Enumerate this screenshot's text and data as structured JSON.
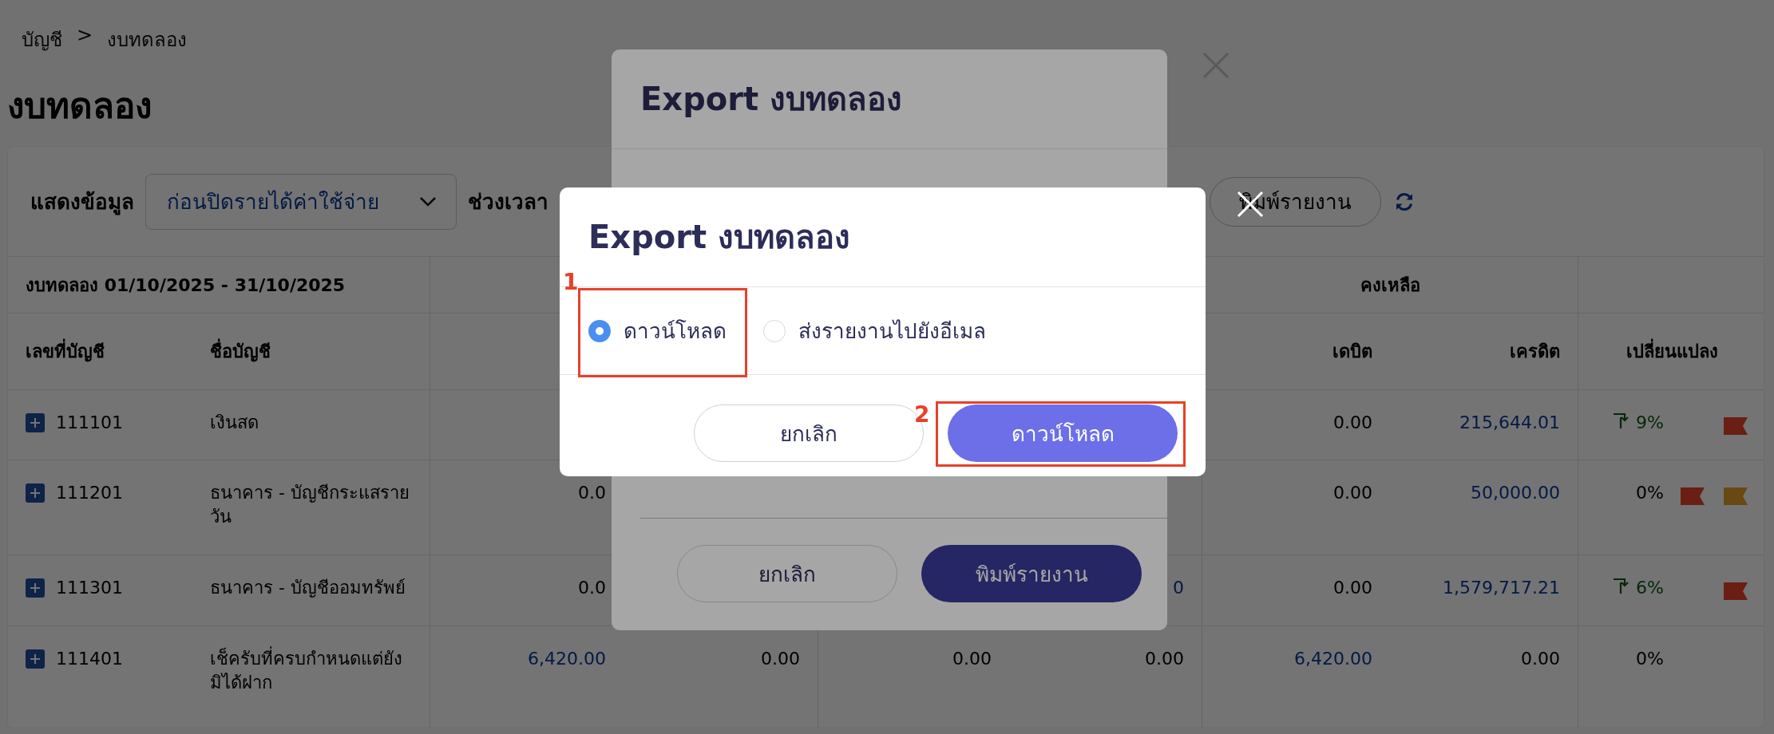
{
  "breadcrumb": [
    "บัญชี",
    ">",
    "งบทดลอง"
  ],
  "page_title": "งบทดลอง",
  "filters": {
    "show_label": "แสดงข้อมูล",
    "show_value": "ก่อนปิดรายได้ค่าใช้จ่าย",
    "period_label": "ช่วงเวลา",
    "print_button": "พิมพ์รายงาน"
  },
  "table": {
    "caption": "งบทดลอง 01/10/2025 - 31/10/2025",
    "group": "คงเหลือ",
    "columns": [
      "เลขที่บัญชี",
      "ชื่อบัญชี",
      "เดบิต",
      "เครดิต",
      "เปลี่ยนแปลง"
    ],
    "rows": [
      {
        "code": "111101",
        "name": "เงินสด",
        "cells": [
          null,
          null,
          null,
          null
        ],
        "debit": {
          "text": "0.00",
          "link": false
        },
        "credit": {
          "text": "215,644.01",
          "link": true
        },
        "change": "9%",
        "trend_up": true,
        "flags": [
          {
            "color": "#6a2014"
          }
        ]
      },
      {
        "code": "111201",
        "name": "ธนาคาร - บัญชีกระแสรายวัน",
        "cells": [
          {
            "text": "0.0",
            "link": false
          },
          null,
          null,
          null
        ],
        "debit": {
          "text": "0.00",
          "link": false
        },
        "credit": {
          "text": "50,000.00",
          "link": true
        },
        "change": "0%",
        "trend_up": false,
        "flags": [
          {
            "color": "#6a2014"
          },
          {
            "color": "#6a4a14"
          }
        ]
      },
      {
        "code": "111301",
        "name": "ธนาคาร - บัญชีออมทรัพย์",
        "cells": [
          {
            "text": "0.0",
            "link": false
          },
          null,
          null,
          {
            "text": "0",
            "link": true
          }
        ],
        "debit": {
          "text": "0.00",
          "link": false
        },
        "credit": {
          "text": "1,579,717.21",
          "link": true
        },
        "change": "6%",
        "trend_up": true,
        "flags": [
          {
            "color": "#6a2014"
          }
        ]
      },
      {
        "code": "111401",
        "name": "เช็ครับที่ครบกำหนดแต่ยังมิได้ฝาก",
        "cells": [
          {
            "text": "6,420.00",
            "link": true
          },
          {
            "text": "0.00",
            "link": false
          },
          {
            "text": "0.00",
            "link": false
          },
          {
            "text": "0.00",
            "link": false
          }
        ],
        "debit": {
          "text": "6,420.00",
          "link": true
        },
        "credit": {
          "text": "0.00",
          "link": false
        },
        "change": "0%",
        "trend_up": false,
        "flags": []
      }
    ]
  },
  "dialog_back": {
    "title": "Export งบทดลอง",
    "buttons": [
      {
        "label": "ยกเลิก",
        "kind": "secondary"
      },
      {
        "label": "พิมพ์รายงาน",
        "kind": "primary"
      }
    ]
  },
  "dialog": {
    "title": "Export งบทดลอง",
    "options": [
      {
        "label": "ดาวน์โหลด",
        "selected": true
      },
      {
        "label": "ส่งรายงานไปยังอีเมล",
        "selected": false
      }
    ],
    "buttons": [
      {
        "label": "ยกเลิก",
        "kind": "secondary"
      },
      {
        "label": "ดาวน์โหลด",
        "kind": "primary"
      }
    ]
  },
  "annotations": [
    {
      "label": "1"
    },
    {
      "label": "2"
    }
  ]
}
